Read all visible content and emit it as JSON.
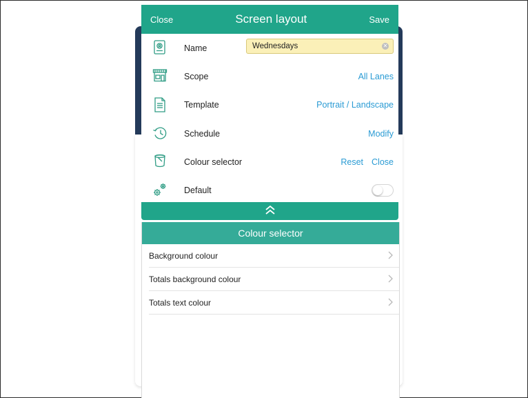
{
  "header": {
    "close_label": "Close",
    "title": "Screen layout",
    "save_label": "Save"
  },
  "form": {
    "name": {
      "label": "Name",
      "value": "Wednesdays"
    },
    "scope": {
      "label": "Scope",
      "value": "All Lanes"
    },
    "template": {
      "label": "Template",
      "value": "Portrait / Landscape"
    },
    "schedule": {
      "label": "Schedule",
      "value": "Modify"
    },
    "colour_selector": {
      "label": "Colour selector",
      "reset_label": "Reset",
      "close_label": "Close"
    },
    "default": {
      "label": "Default",
      "enabled": false
    }
  },
  "icons": {
    "name": "contact-card-icon",
    "scope": "storefront-icon",
    "template": "document-icon",
    "schedule": "history-clock-icon",
    "colour_selector": "paint-bucket-icon",
    "default": "gears-icon",
    "collapse": "double-chevron-up-icon",
    "list_item": "chevron-right-icon"
  },
  "colour_selector": {
    "title": "Colour selector",
    "items": [
      {
        "label": "Background colour"
      },
      {
        "label": "Totals background colour"
      },
      {
        "label": "Totals text colour"
      }
    ]
  },
  "colors": {
    "accent": "#20a58a",
    "link": "#2a9bd4",
    "name_field_bg": "#fbf0b8"
  }
}
